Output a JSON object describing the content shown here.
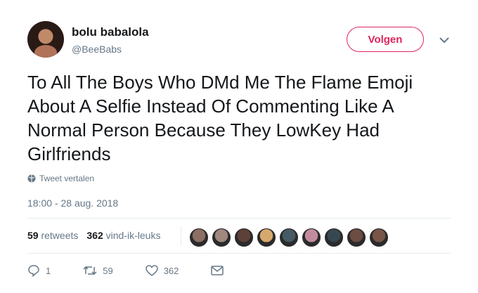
{
  "user": {
    "name": "bolu babalola",
    "handle": "@BeeBabs"
  },
  "follow_label": "Volgen",
  "tweet_text": "To All The Boys Who DMd Me The Flame Emoji About A Selfie Instead Of Commenting Like A Normal Person Because They LowKey Had Girlfriends",
  "translate_label": "Tweet vertalen",
  "timestamp": "18:00 - 28 aug. 2018",
  "stats": {
    "retweets_count": "59",
    "retweets_label": "retweets",
    "likes_count": "362",
    "likes_label": "vind-ik-leuks"
  },
  "liker_avatar_colors": [
    "#8d6e63",
    "#a1887f",
    "#5d4037",
    "#d7a86e",
    "#455a64",
    "#c48b9f",
    "#37474f",
    "#6d4c41",
    "#795548"
  ],
  "actions": {
    "reply_count": "1",
    "retweet_count": "59",
    "like_count": "362"
  },
  "icons": [
    "chevron-down-icon",
    "globe-icon",
    "reply-icon",
    "retweet-icon",
    "heart-icon",
    "mail-icon"
  ],
  "colors": {
    "accent": "#e0245e",
    "secondary_text": "#657786"
  }
}
